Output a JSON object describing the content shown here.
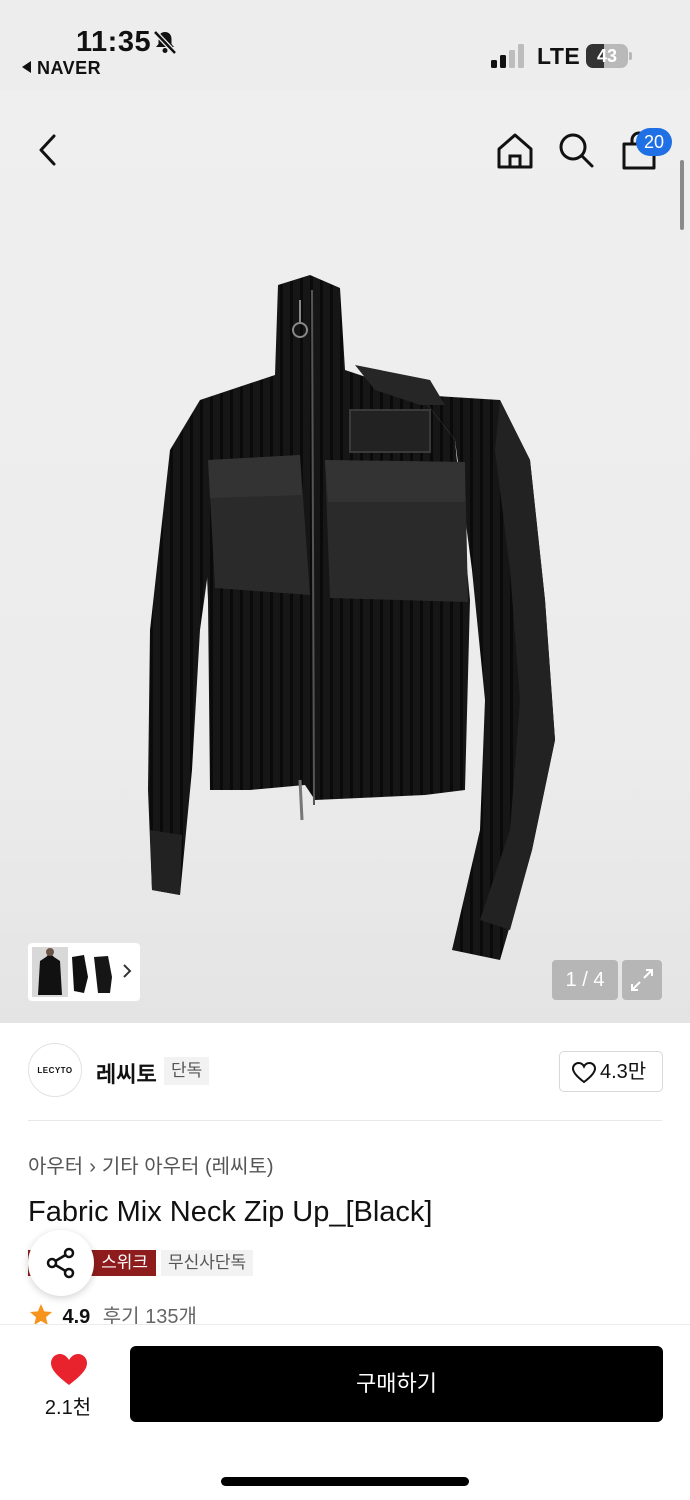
{
  "status_bar": {
    "time": "11:35",
    "back_app": "NAVER",
    "network": "LTE",
    "battery": "43",
    "battery_level": 0.43
  },
  "header": {
    "cart_count": "20",
    "icons": [
      "back-icon",
      "home-icon",
      "search-icon",
      "cart-icon"
    ]
  },
  "gallery": {
    "counter": "1 / 4",
    "current": 1,
    "total": 4
  },
  "brand": {
    "logo_text": "LECYTO",
    "name": "레씨토",
    "badge": "단독",
    "likes": "4.3만"
  },
  "breadcrumb": {
    "category": "아우터",
    "subcategory": "기타 아우터 (레씨토)"
  },
  "product": {
    "title": "Fabric Mix Neck Zip Up_[Black]",
    "tags": [
      "스위크",
      "무신사단독"
    ],
    "rating": "4.9",
    "reviews": "후기 135개"
  },
  "bottom_bar": {
    "favorite_count": "2.1천",
    "buy_label": "구매하기"
  },
  "colors": {
    "accent_blue": "#1f6fe5",
    "tag_red": "#8e1c1c",
    "heart_red": "#e8232e",
    "star_orange": "#f7941d",
    "buy_button": "#000000"
  }
}
